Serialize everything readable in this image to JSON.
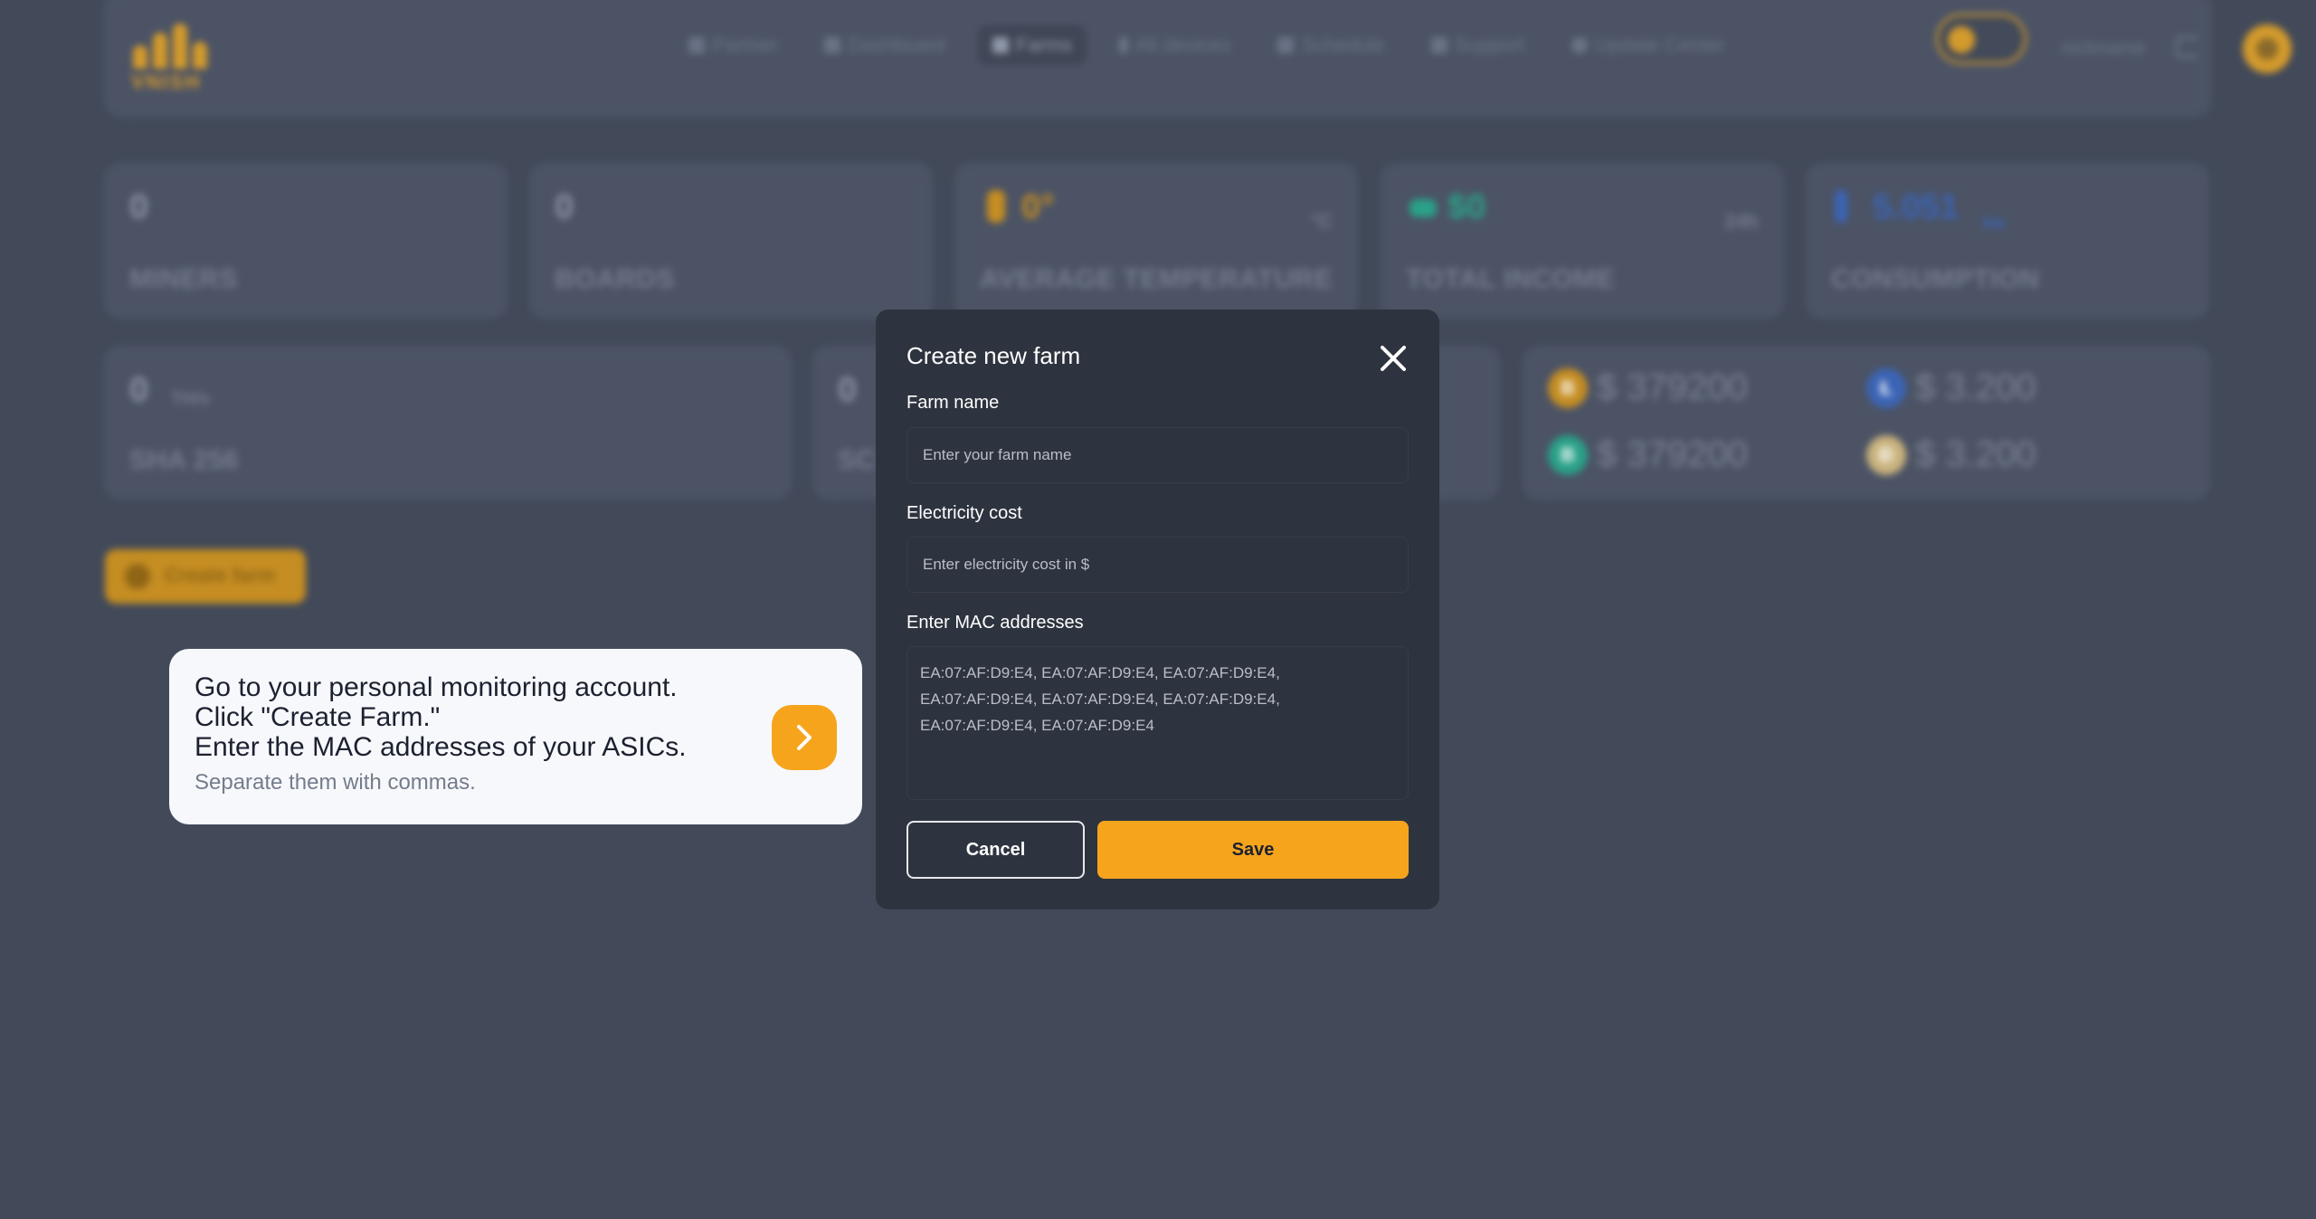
{
  "brand": {
    "logo_text": "VNISH"
  },
  "nav": {
    "items": [
      {
        "label": "Partner",
        "icon": "partner-icon"
      },
      {
        "label": "Dashboard",
        "icon": "dashboard-icon"
      },
      {
        "label": "Farms",
        "icon": "farms-icon",
        "active": true
      },
      {
        "label": "All devices",
        "icon": "lightning-icon"
      },
      {
        "label": "Schedule",
        "icon": "calendar-icon"
      },
      {
        "label": "Support",
        "icon": "chat-icon"
      },
      {
        "label": "Update Center",
        "icon": "gear-icon"
      }
    ],
    "nickname": "nickname"
  },
  "stats": {
    "miners": {
      "value": "0",
      "label": "MINERS"
    },
    "boards": {
      "value": "0",
      "label": "BOARDS"
    },
    "temperature": {
      "value": "0°",
      "unit": "°C",
      "label": "AVERAGE TEMPERATURE"
    },
    "income": {
      "value": "$0",
      "unit": "24h",
      "label": "TOTAL INCOME"
    },
    "consumption": {
      "value": "5.051",
      "unit": "kw",
      "label": "CONSUMPTION"
    }
  },
  "hashrate": {
    "sha256": {
      "value": "0",
      "unit": "TH/s",
      "label": "SHA 256"
    },
    "scrypt": {
      "value": "0",
      "label": "SC"
    }
  },
  "prices": [
    {
      "symbol": "B",
      "value": "$ 379200",
      "color": "#c58d22"
    },
    {
      "symbol": "Ł",
      "value": "$ 3.200",
      "color": "#3b64b5"
    },
    {
      "symbol": "B",
      "value": "$ 379200",
      "color": "#2aa188"
    },
    {
      "symbol": "Đ",
      "value": "$ 3.200",
      "color": "#c9b37d"
    }
  ],
  "actions": {
    "create_farm_label": "Create farm"
  },
  "tip": {
    "line1": "Go to your personal monitoring account.",
    "line2": "Click \"Create Farm.\"",
    "line3": "Enter the MAC addresses of your ASICs.",
    "sub": "Separate them with commas."
  },
  "modal": {
    "title": "Create new farm",
    "farm_name_label": "Farm name",
    "farm_name_placeholder": "Enter your farm name",
    "electricity_label": "Electricity cost",
    "electricity_placeholder": "Enter electricity cost in $",
    "mac_label": "Enter MAC addresses",
    "mac_value": "EA:07:AF:D9:E4, EA:07:AF:D9:E4, EA:07:AF:D9:E4,\nEA:07:AF:D9:E4, EA:07:AF:D9:E4, EA:07:AF:D9:E4,\nEA:07:AF:D9:E4, EA:07:AF:D9:E4",
    "cancel_label": "Cancel",
    "save_label": "Save"
  },
  "colors": {
    "accent": "#f7a41d",
    "modal_bg": "#2e343f",
    "page_bg": "#424a5a"
  }
}
